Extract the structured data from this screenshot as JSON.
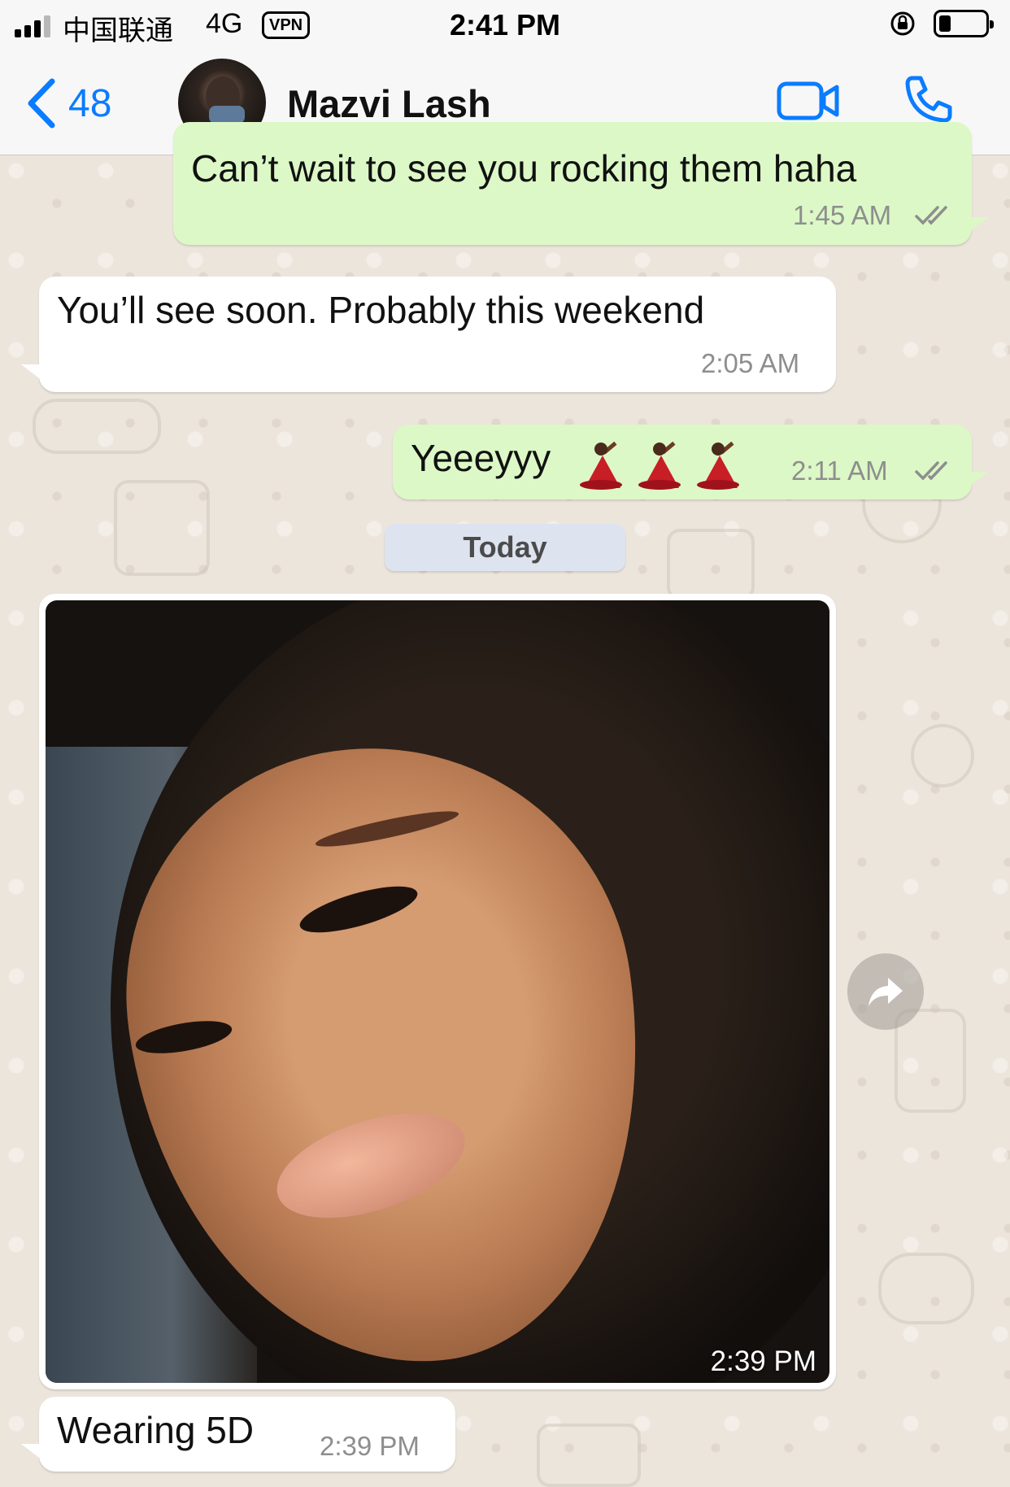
{
  "status_bar": {
    "carrier": "中国联通",
    "network": "4G",
    "vpn": "VPN",
    "time": "2:41 PM",
    "icons": [
      "signal-icon",
      "orientation-lock-icon",
      "battery-icon"
    ]
  },
  "header": {
    "back_count": "48",
    "contact_name": "Mazvi Lash",
    "icons": [
      "chevron-left-icon",
      "avatar",
      "video-call-icon",
      "phone-icon"
    ]
  },
  "messages": [
    {
      "direction": "outgoing",
      "text": "Can’t wait to see you rocking them haha",
      "time": "1:45 AM",
      "status": "read"
    },
    {
      "direction": "incoming",
      "text": "You’ll see soon. Probably this weekend",
      "time": "2:05 AM"
    },
    {
      "direction": "outgoing",
      "text": "Yeeeyyy",
      "emoji": "💃🏾💃🏾💃🏾",
      "time": "2:11 AM",
      "status": "read"
    },
    {
      "direction": "incoming",
      "type": "image",
      "time": "2:39 PM"
    },
    {
      "direction": "incoming",
      "text": "Wearing 5D",
      "time": "2:39 PM"
    }
  ],
  "date_divider": "Today",
  "colors": {
    "outgoing_bubble": "#dcf8c6",
    "incoming_bubble": "#ffffff",
    "accent": "#0a7cff",
    "read_ticks": "#8e8e8e",
    "wallpaper": "#ece5dc"
  }
}
